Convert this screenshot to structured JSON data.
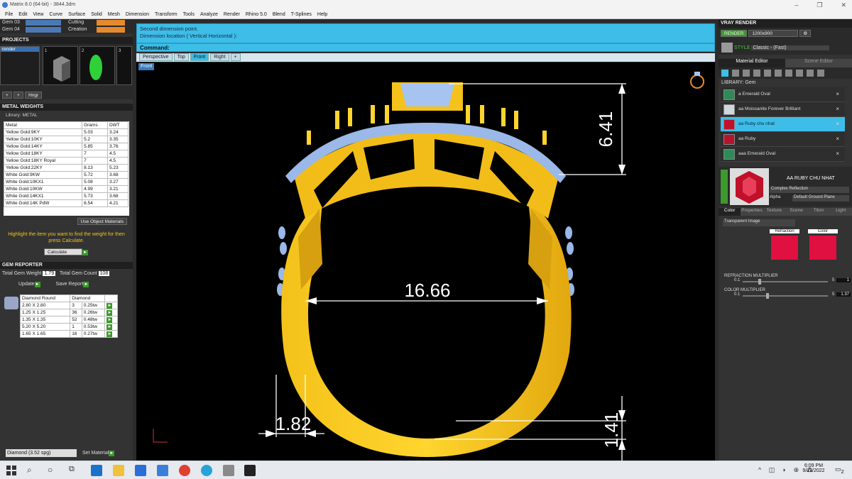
{
  "window": {
    "title": "Matrix 8.0 (64-bit) - 3844.3dm"
  },
  "menu": [
    "File",
    "Edit",
    "View",
    "Curve",
    "Surface",
    "Solid",
    "Mesh",
    "Dimension",
    "Transform",
    "Tools",
    "Analyze",
    "Render",
    "Rhino 5.0",
    "Blend",
    "T-Splines",
    "Help"
  ],
  "gem_rows": [
    {
      "label": "Gem 03",
      "right": "Cutting"
    },
    {
      "label": "Gem 04",
      "right": "Creation"
    }
  ],
  "projects": {
    "header": "PROJECTS",
    "item": "render",
    "thumbs": [
      "1",
      "2",
      "3"
    ],
    "button": "Hngr"
  },
  "metal": {
    "header": "METAL WEIGHTS",
    "library_label": "Library: METAL",
    "columns": [
      "Metal",
      "Grams",
      "DWT"
    ],
    "rows": [
      [
        "Yellow Gold:9KY",
        "5.03",
        "3.24"
      ],
      [
        "Yellow Gold:10KY",
        "5.2",
        "3.35"
      ],
      [
        "Yellow Gold:14KY",
        "5.85",
        "3.76"
      ],
      [
        "Yellow Gold:18KY",
        "7",
        "4.5"
      ],
      [
        "Yellow Gold:18KY Royal",
        "7",
        "4.5"
      ],
      [
        "Yellow Gold:22KY",
        "8.13",
        "5.23"
      ],
      [
        "White Gold:9KW",
        "5.72",
        "3.68"
      ],
      [
        "White Gold:10KX1",
        "5.08",
        "3.27"
      ],
      [
        "White Gold:10KW",
        "4.99",
        "3.21"
      ],
      [
        "White Gold:14KX1",
        "5.73",
        "3.68"
      ],
      [
        "White Gold:14K PdW",
        "6.54",
        "4.21"
      ]
    ],
    "use_object": "Use Object Materials",
    "hint": "Highlight the item you want to find the weight for then press Calculate.",
    "calculate": "Calculate"
  },
  "gem_reporter": {
    "header": "GEM REPORTER",
    "total_weight_label": "Total Gem Weight",
    "total_weight": "1.79",
    "total_count_label": "Total Gem Count",
    "total_count": "108",
    "update": "Update",
    "save": "Save Report",
    "columns": [
      "Diamond Round",
      "Diamond"
    ],
    "rows": [
      [
        "2.80 X 2.80",
        "3",
        "0.25tw"
      ],
      [
        "1.25 X 1.25",
        "36",
        "0.26tw"
      ],
      [
        "1.35 X 1.35",
        "52",
        "0.48tw"
      ],
      [
        "5.20 X 5.20",
        "1",
        "0.53tw"
      ],
      [
        "1.65 X 1.65",
        "16",
        "0.27tw"
      ]
    ],
    "material_select": "Diamond    (3.52 spg)",
    "set_material": "Set Material"
  },
  "command": {
    "line1": "Second dimension point.",
    "line2": "Dimension location ( Vertical  Horizontal ):",
    "prompt": "Command:"
  },
  "viewport": {
    "tabs": [
      "Perspective",
      "Top",
      "Front",
      "Right"
    ],
    "active_tab": "Front",
    "label": "Front",
    "dims": {
      "top": "6.41",
      "width": "16.66",
      "bottom": "1.41",
      "side": "1.82"
    }
  },
  "vray": {
    "header": "VRAY RENDER",
    "render": "RENDER",
    "resolution": "1200x900",
    "style_label": "STYLE",
    "style_value": "Classic - (Fast)",
    "tabs": [
      "Material Editor",
      "Scene Editor"
    ],
    "library": "LIBRARY: Gem",
    "materials": [
      {
        "name": "a Emerald Oval",
        "color": "#2e8b57"
      },
      {
        "name": "aa Moissanite Forever Brilliant",
        "color": "#cfd6dc"
      },
      {
        "name": "aa Ruby chu nhat",
        "color": "#c0102a"
      },
      {
        "name": "aa Ruby",
        "color": "#b5142c"
      },
      {
        "name": "aaa Emerald Oval",
        "color": "#2e8b57"
      }
    ],
    "selected_name": "AA RUBY CHU NHAT",
    "reflection": "Complex Reflection",
    "alpha": "Alpha",
    "ground": "Default Ground Plane",
    "subtabs": [
      "Color",
      "Properties",
      "Texture",
      "Scene",
      "Titon",
      "Light"
    ],
    "dropdown": "Transparent Image",
    "refraction_label": "Refraction",
    "color_label": "Color",
    "refr_mult_label": "REFRACTION MULTIPLIER",
    "refr_min": "0.1",
    "refr_max": "5",
    "refr_val": "1",
    "color_mult_label": "COLOR MULTIPLIER",
    "color_min": "0.1",
    "color_max": "5",
    "color_val": "1.37"
  },
  "taskbar": {
    "time": "6:09 PM",
    "date": "9/12/2022",
    "notif": "2"
  }
}
